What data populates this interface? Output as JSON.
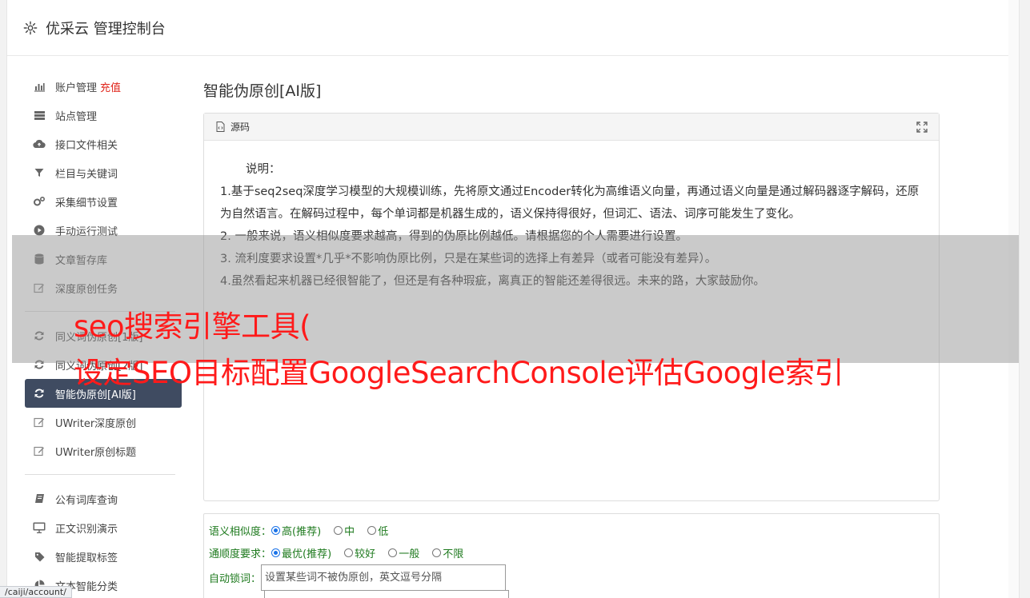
{
  "header": {
    "title": "优采云 管理控制台",
    "icon": "gear-icon"
  },
  "sidebar": {
    "items": [
      {
        "label": "账户管理",
        "badge": "充值",
        "icon": "bar-chart-icon"
      },
      {
        "label": "站点管理",
        "icon": "server-icon"
      },
      {
        "label": "接口文件相关",
        "icon": "cloud-upload-icon"
      },
      {
        "label": "栏目与关键词",
        "icon": "filter-icon"
      },
      {
        "label": "采集细节设置",
        "icon": "cogs-icon"
      },
      {
        "label": "手动运行测试",
        "icon": "play-circle-icon"
      },
      {
        "label": "文章暂存库",
        "icon": "database-icon"
      },
      {
        "label": "深度原创任务",
        "icon": "edit-icon"
      },
      {
        "label": "同义词伪原创[1版]",
        "icon": "refresh-icon"
      },
      {
        "label": "同义词伪原创[2版]",
        "icon": "refresh-icon"
      },
      {
        "label": "智能伪原创[AI版]",
        "icon": "refresh-icon"
      },
      {
        "label": "UWriter深度原创",
        "icon": "edit-icon"
      },
      {
        "label": "UWriter原创标题",
        "icon": "edit-icon"
      },
      {
        "label": "公有词库查询",
        "icon": "book-icon"
      },
      {
        "label": "正文识别演示",
        "icon": "desktop-icon"
      },
      {
        "label": "智能提取标签",
        "icon": "tag-icon"
      },
      {
        "label": "文本智能分类",
        "icon": "pie-chart-icon"
      }
    ]
  },
  "content": {
    "title": "智能伪原创[AI版]",
    "panel_title": "源码",
    "desc_heading": "说明：",
    "desc_1": "1.基于seq2seq深度学习模型的大规模训练，先将原文通过Encoder转化为高维语义向量，再通过语义向量是通过解码器逐字解码，还原为自然语言。在解码过程中，每个单词都是机器生成的，语义保持得很好，但词汇、语法、词序可能发生了变化。",
    "desc_2": "2. 一般来说，语义相似度要求越高，得到的伪原比例越低。请根据您的个人需要进行设置。",
    "desc_3": "3. 流利度要求设置*几乎*不影响伪原比例，只是在某些词的选择上有差异（或者可能没有差异）。",
    "desc_4": "4.虽然看起来机器已经很智能了，但还是有各种瑕疵，离真正的智能还差得很远。未来的路，大家鼓励你。"
  },
  "options": {
    "similarity_label": "语义相似度：",
    "similarity_opts": [
      "高(推荐)",
      "中",
      "低"
    ],
    "fluency_label": "通顺度要求：",
    "fluency_opts": [
      "最优(推荐)",
      "较好",
      "一般",
      "不限"
    ],
    "lock_label": "自动锁词：",
    "lock_placeholder": "设置某些词不被伪原创，英文逗号分隔"
  },
  "overlay": {
    "line1": "seo搜索引擎工具(",
    "line2": "设定SEO目标配置GoogleSearchConsole评估Google索引"
  },
  "statusbar": {
    "url": "/caiji/account/"
  },
  "colors": {
    "accent": "#3f4b61",
    "badge": "#e0251b",
    "option_text": "#1e7a1e",
    "headline": "#ff1a1a"
  }
}
